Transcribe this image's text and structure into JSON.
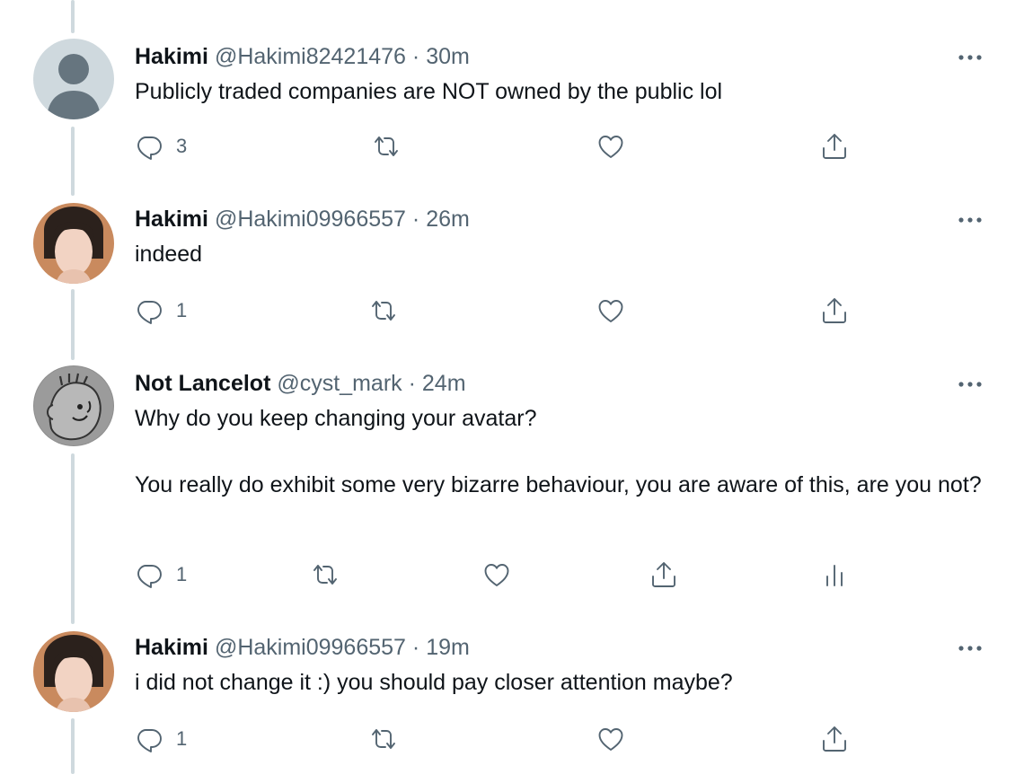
{
  "tweets": [
    {
      "name": "Hakimi",
      "handle": "@Hakimi82421476",
      "sep": "·",
      "time": "30m",
      "avatar": "default-avatar",
      "paragraphs": [
        "Publicly traded companies are NOT owned by the public lol"
      ],
      "reply_count": "3",
      "has_analytics": false
    },
    {
      "name": "Hakimi",
      "handle": "@Hakimi09966557",
      "sep": "·",
      "time": "26m",
      "avatar": "face-avatar",
      "paragraphs": [
        "indeed"
      ],
      "reply_count": "1",
      "has_analytics": false
    },
    {
      "name": "Not Lancelot",
      "handle": "@cyst_mark",
      "sep": "·",
      "time": "24m",
      "avatar": "cartoon-avatar",
      "paragraphs": [
        "Why do you keep changing your avatar?",
        "You really do exhibit some very bizarre behaviour, you are aware of this, are you not?"
      ],
      "reply_count": "1",
      "has_analytics": true
    },
    {
      "name": "Hakimi",
      "handle": "@Hakimi09966557",
      "sep": "·",
      "time": "19m",
      "avatar": "face-avatar",
      "paragraphs": [
        "i did not change it :) you should pay closer attention maybe?"
      ],
      "reply_count": "1",
      "has_analytics": false
    }
  ],
  "icons": {
    "reply": "reply-icon",
    "retweet": "retweet-icon",
    "like": "like-icon",
    "share": "share-icon",
    "analytics": "analytics-icon",
    "more": "more-icon"
  },
  "colors": {
    "text": "#0f1419",
    "secondary": "#536471",
    "thread_line": "#cfd9de"
  }
}
